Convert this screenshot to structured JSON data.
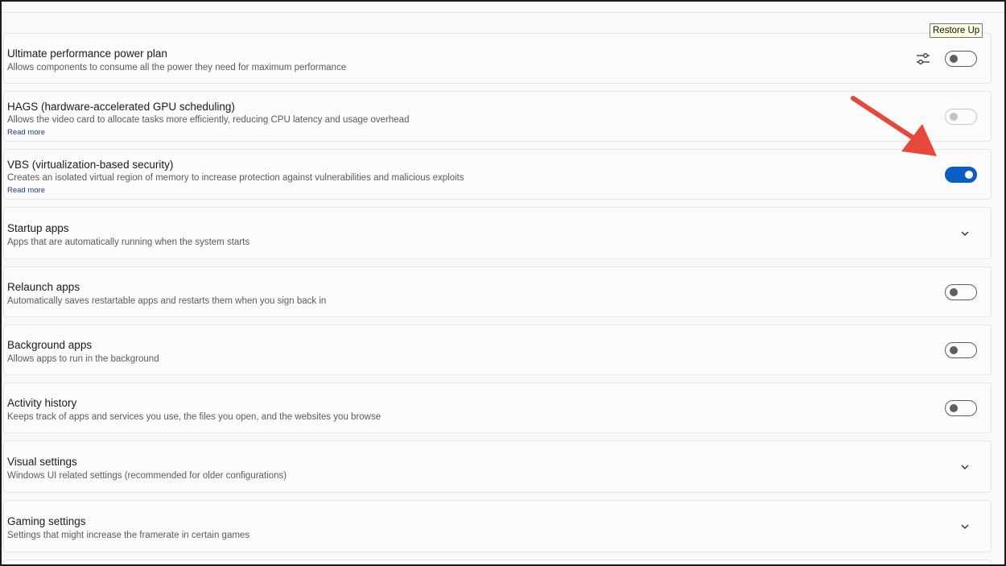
{
  "tooltip": {
    "text": "Restore Up"
  },
  "settings": [
    {
      "title": "Ultimate performance power plan",
      "desc": "Allows components to consume all the power they need for maximum performance",
      "control": "toggle",
      "state": "off"
    },
    {
      "title": "HAGS (hardware-accelerated GPU scheduling)",
      "desc": "Allows the video card to allocate tasks more efficiently, reducing CPU latency and usage overhead",
      "read_more": "Read more",
      "control": "toggle",
      "state": "disabled"
    },
    {
      "title": "VBS (virtualization-based security)",
      "desc": "Creates an isolated virtual region of memory to increase protection against vulnerabilities and malicious exploits",
      "read_more": "Read more",
      "control": "toggle",
      "state": "on"
    },
    {
      "title": "Startup apps",
      "desc": "Apps that are automatically running when the system starts",
      "control": "expander"
    },
    {
      "title": "Relaunch apps",
      "desc": "Automatically saves restartable apps and restarts them when you sign back in",
      "control": "toggle",
      "state": "off"
    },
    {
      "title": "Background apps",
      "desc": "Allows apps to run in the background",
      "control": "toggle",
      "state": "off"
    },
    {
      "title": "Activity history",
      "desc": "Keeps track of apps and services you use, the files you open, and the websites you browse",
      "control": "toggle",
      "state": "off"
    },
    {
      "title": "Visual settings",
      "desc": "Windows UI related settings (recommended for older configurations)",
      "control": "expander"
    },
    {
      "title": "Gaming settings",
      "desc": "Settings that might increase the framerate in certain games",
      "control": "expander"
    }
  ],
  "colors": {
    "accent": "#0b5cc5",
    "annotation_arrow": "#e8473c"
  },
  "icons": {
    "tune": "sliders-icon",
    "expand": "chevron-down-icon",
    "annotation": "red-arrow"
  }
}
